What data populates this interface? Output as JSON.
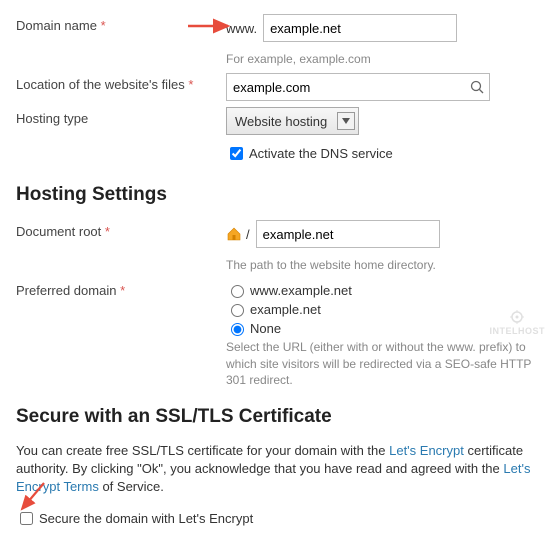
{
  "domain": {
    "label": "Domain name",
    "prefix": "www.",
    "value": "example.net",
    "helper": "For example, example.com"
  },
  "location": {
    "label": "Location of the website's files",
    "value": "example.com"
  },
  "hosting_type": {
    "label": "Hosting type",
    "selected": "Website hosting",
    "dns_checkbox": "Activate the DNS service",
    "dns_checked": true
  },
  "section_hosting": "Hosting Settings",
  "docroot": {
    "label": "Document root",
    "slash": "/",
    "value": "example.net",
    "helper": "The path to the website home directory."
  },
  "preferred": {
    "label": "Preferred domain",
    "options": [
      "www.example.net",
      "example.net",
      "None"
    ],
    "selected": "None",
    "helper": "Select the URL (either with or without the www. prefix) to which site visitors will be redirected via a SEO-safe HTTP 301 redirect."
  },
  "section_ssl": "Secure with an SSL/TLS Certificate",
  "ssl_text": {
    "p1a": "You can create free SSL/TLS certificate for your domain with the ",
    "link1": "Let's Encrypt",
    "p1b": " certificate authority. By clicking \"Ok\", you acknowledge that you have read and agreed with the ",
    "link2": "Let's Encrypt Terms",
    "p1c": " of Service."
  },
  "ssl_checkbox": {
    "label": "Secure the domain with Let's Encrypt",
    "checked": false
  },
  "watermark": "INTELHOST"
}
